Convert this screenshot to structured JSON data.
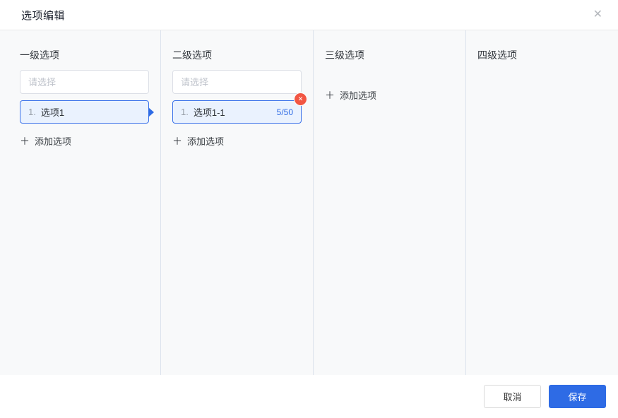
{
  "dialog": {
    "title": "选项编辑"
  },
  "icons": {
    "close": "✕",
    "delete": "✕",
    "plus": "＋"
  },
  "columns": [
    {
      "header": "一级选项",
      "placeholder": "请选择",
      "item": {
        "index": "1.",
        "label": "选项1"
      },
      "add_label": "添加选项"
    },
    {
      "header": "二级选项",
      "placeholder": "请选择",
      "item": {
        "index": "1.",
        "label": "选项1-1",
        "counter": "5/50"
      },
      "add_label": "添加选项"
    },
    {
      "header": "三级选项",
      "add_label": "添加选项"
    },
    {
      "header": "四级选项"
    }
  ],
  "footer": {
    "cancel_label": "取消",
    "save_label": "保存"
  },
  "colors": {
    "primary_blue": "#2e6be5",
    "selected_item_bg": "#eaf2fe",
    "selected_item_border": "#3b72ea",
    "delete_badge_red": "#f25643",
    "counter_text": "#2e6be5",
    "panel_background": "#f8f9fa",
    "column_divider": "#dce3ed",
    "input_border": "#dcdfe6",
    "placeholder_text": "#c0c4cc"
  }
}
